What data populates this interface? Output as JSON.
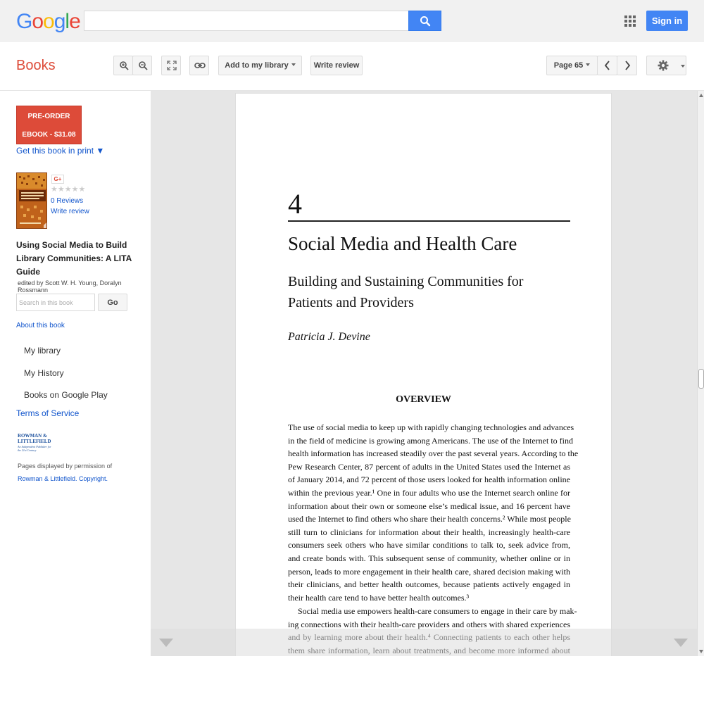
{
  "header": {
    "logo_letters": [
      {
        "ch": "G",
        "color": "#4285f4"
      },
      {
        "ch": "o",
        "color": "#ea4335"
      },
      {
        "ch": "o",
        "color": "#fbbc05"
      },
      {
        "ch": "g",
        "color": "#4285f4"
      },
      {
        "ch": "l",
        "color": "#34a853"
      },
      {
        "ch": "e",
        "color": "#ea4335"
      }
    ],
    "search_value": "",
    "search_icon": "search-icon",
    "apps_icon": "apps-grid-icon",
    "signin_label": "Sign in"
  },
  "toolbar": {
    "section_title": "Books",
    "add_library_label": "Add to my library",
    "write_review_label": "Write review",
    "page_label": "Page 65",
    "icons": [
      "zoom-in-icon",
      "zoom-out-icon",
      "fullscreen-icon",
      "link-icon",
      "prev-page-icon",
      "next-page-icon",
      "gear-icon"
    ]
  },
  "sidebar": {
    "preorder_line1": "PRE-ORDER",
    "preorder_line2": "EBOOK - $31.08",
    "get_print": "Get this book in print ▼",
    "gplus": "G+",
    "stars": "★★★★★",
    "reviews_count": "0 Reviews",
    "write_review": "Write review",
    "book_title": "Using Social Media to Build Library Communities: A LITA Guide",
    "authors": "edited by Scott W. H. Young, Doralyn Rossmann",
    "search_placeholder": "Search in this book",
    "go_label": "Go",
    "about": "About this book",
    "nav": [
      "My library",
      "My History",
      "Books on Google Play"
    ],
    "terms": "Terms of Service",
    "publisher_logo": {
      "line1": "ROWMAN &",
      "line2": "LITTLEFIELD",
      "line3": "An Independent Publisher for the 21st Century"
    },
    "permission_text": "Pages displayed by permission of",
    "permission_link": "Rowman & Littlefield. Copyright."
  },
  "page": {
    "chapter_number": "4",
    "chapter_title": "Social Media and Health Care",
    "subtitle_line1": "Building and Sustaining Communities for",
    "subtitle_line2": "Patients and Providers",
    "author": "Patricia J. Devine",
    "section_heading": "OVERVIEW",
    "paragraph1_lines": [
      "The use of social media to keep up with rapidly changing technologies and advances",
      "in the field of medicine is growing among Americans. The use of the Internet to find",
      "health information has increased steadily over the past several years. According to the",
      "Pew Research Center, 87 percent of adults in the United States used the Internet as",
      "of January 2014, and 72 percent of those users looked for health information online",
      "within the previous year.¹ One in four adults who use the Internet search online for",
      "information about their own or someone else’s medical issue, and 16 percent have",
      "used the Internet to find others who share their health concerns.² While most people",
      "still turn to clinicians for information about their health, increasingly health-care",
      "consumers seek others who have similar conditions to talk to, seek advice from,",
      "and create bonds with. This subsequent sense of community, whether online or in",
      "person, leads to more engagement in their health care, shared decision making with",
      "their clinicians, and better health outcomes, because patients actively engaged in",
      "their health care tend to have better health outcomes.³"
    ],
    "paragraph2_lines": [
      "Social media use empowers health-care consumers to engage in their care by mak-",
      "ing connections with their health-care providers and others with shared experiences",
      "and by learning more about their health.⁴ Connecting patients to each other helps",
      "them share information, learn about treatments, and become more informed about"
    ]
  }
}
